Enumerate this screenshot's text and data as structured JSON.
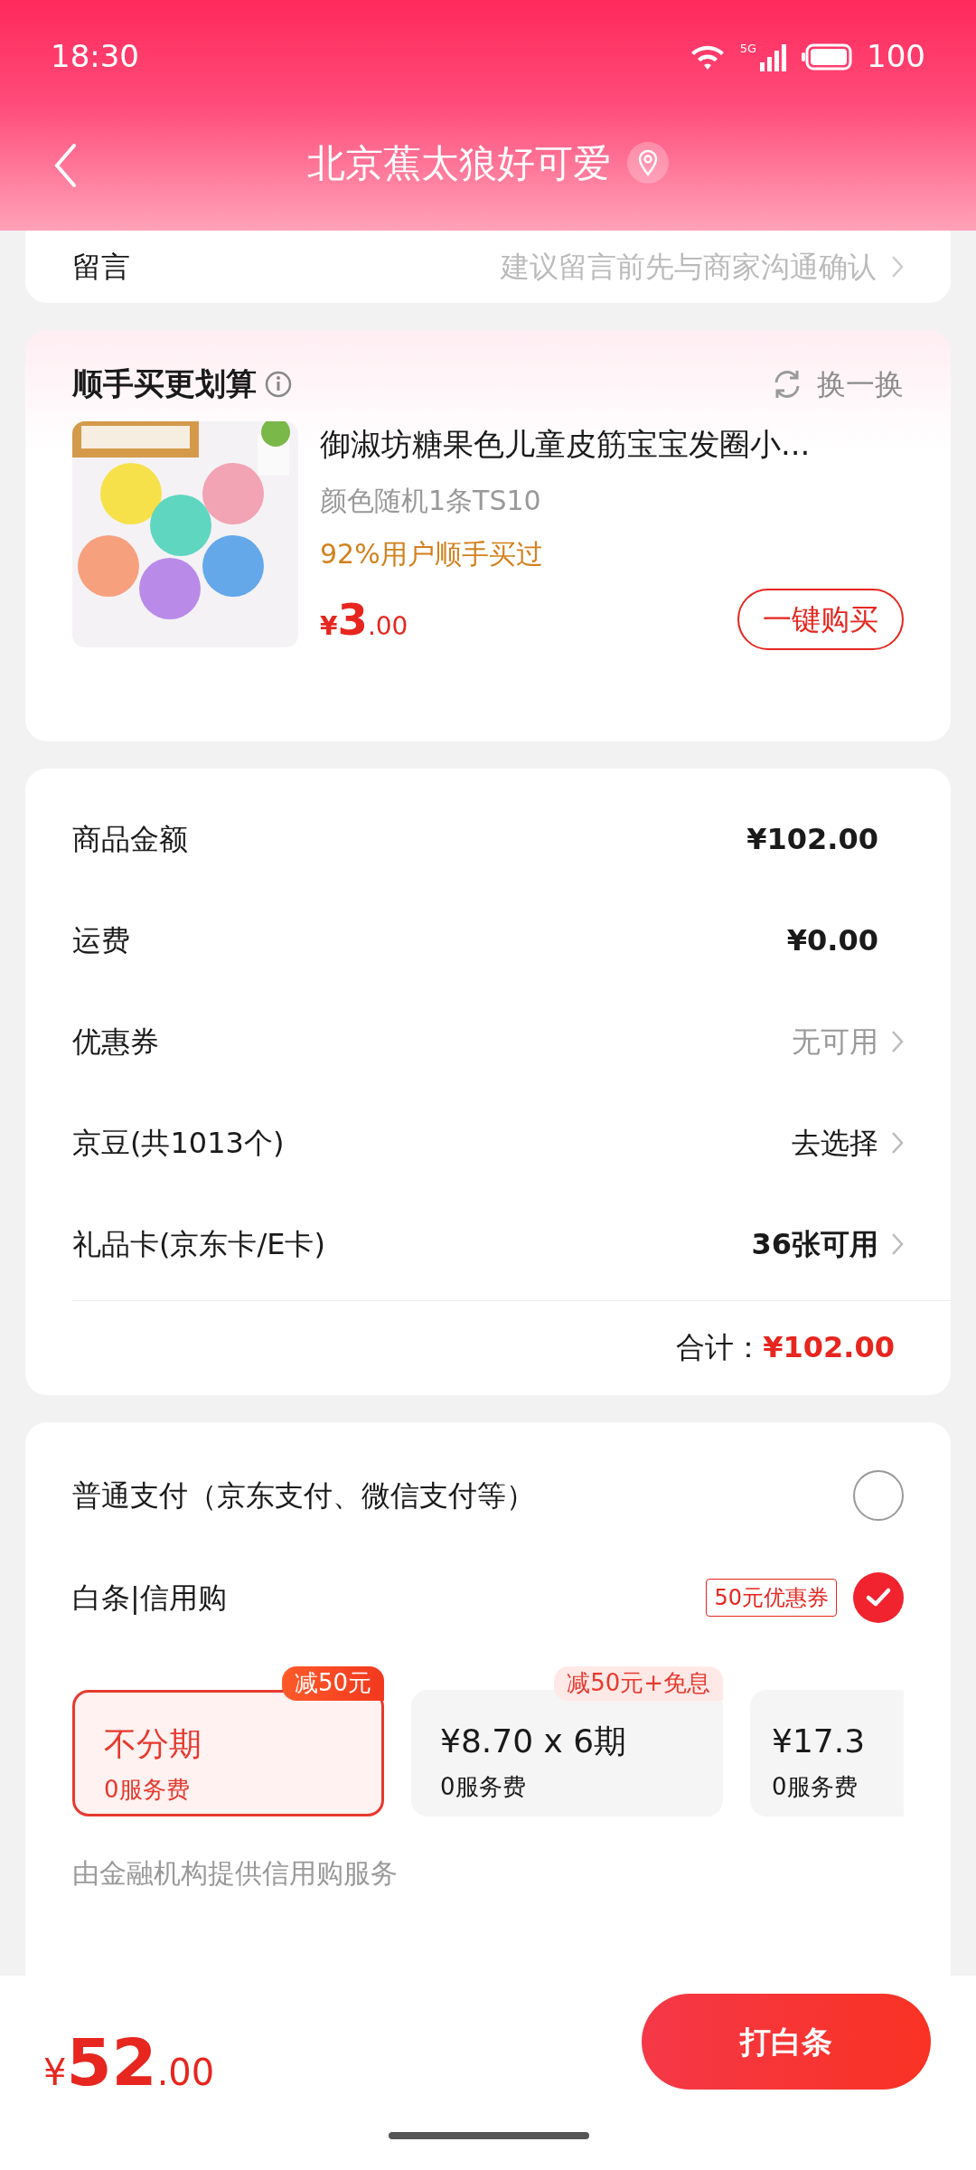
{
  "status_bar": {
    "time": "18:30",
    "network": "5G",
    "battery": "100"
  },
  "header": {
    "title": "北京蕉太狼好可爱"
  },
  "note": {
    "label": "留言",
    "placeholder": "建议留言前先与商家沟通确认"
  },
  "recommend": {
    "title": "顺手买更划算",
    "refresh": "换一换",
    "product": {
      "kind": "picture",
      "title": "御淑坊糖果色儿童皮筋宝宝发圈小...",
      "spec": "颜色随机1条TS10",
      "promo": "92%用户顺手买过",
      "currency": "¥",
      "price_int": "3",
      "price_dec": ".00",
      "button": "一键购买"
    }
  },
  "summary": {
    "rows": [
      {
        "label": "商品金额",
        "value": "¥102.00",
        "kind": "amount"
      },
      {
        "label": "运费",
        "value": "¥0.00",
        "kind": "amount"
      },
      {
        "label": "优惠券",
        "value": "无可用",
        "kind": "muted_link"
      },
      {
        "label": "京豆(共1013个)",
        "value": "去选择",
        "kind": "link"
      },
      {
        "label": "礼品卡(京东卡/E卡)",
        "value": "36张可用",
        "kind": "strong_link"
      }
    ],
    "total_label": "合计：",
    "total_value": "¥102.00"
  },
  "payment": {
    "options": [
      {
        "label": "普通支付（京东支付、微信支付等）",
        "selected": false
      },
      {
        "label": "白条|信用购",
        "badge": "50元优惠券",
        "selected": true
      }
    ],
    "plans": [
      {
        "title": "不分期",
        "fee": "0服务费",
        "tag": "减50元",
        "selected": true
      },
      {
        "title": "¥8.70 x 6期",
        "fee": "0服务费",
        "tag": "减50元+免息",
        "selected": false
      },
      {
        "title": "¥17.3",
        "fee": "0服务费",
        "selected": false
      }
    ],
    "note": "由金融机构提供信用购服务"
  },
  "bottom_bar": {
    "currency": "¥",
    "price_int": "52",
    "price_dec": ".00",
    "button": "打白条"
  }
}
